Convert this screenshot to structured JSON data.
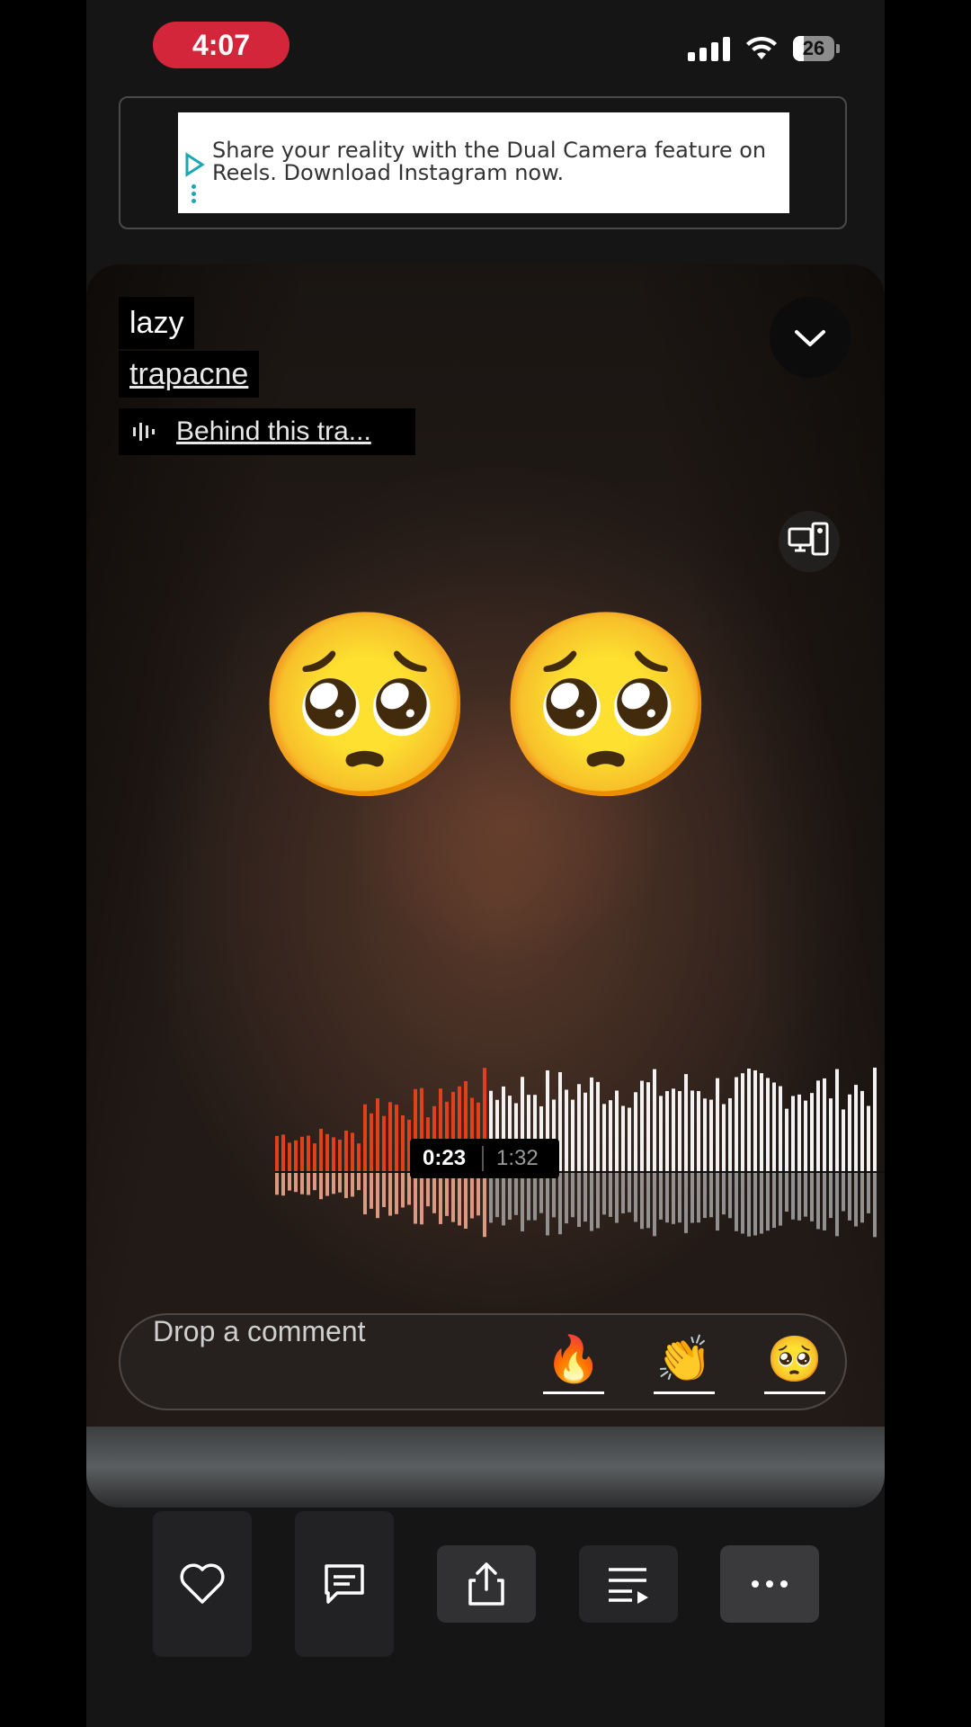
{
  "status_bar": {
    "time": "4:07",
    "battery": "26"
  },
  "ad": {
    "text": "Share your reality with the Dual Camera feature on Reels. Download Instagram now."
  },
  "track": {
    "title": "lazy",
    "artist": "trapacne",
    "behind_label": "Behind this tra..."
  },
  "player": {
    "current_time": "0:23",
    "duration": "1:32",
    "progress": 0.25
  },
  "overlay": {
    "emoji": "🥺"
  },
  "comment": {
    "placeholder": "Drop a comment",
    "reactions": [
      "🔥",
      "👏",
      "🥺"
    ]
  },
  "actions": [
    "heart-icon",
    "comment-icon",
    "share-icon",
    "queue-icon",
    "more-icon"
  ],
  "colors": {
    "played": "#e0401a",
    "unplayed": "#f2f2f2",
    "time_pill": "#d4263b"
  }
}
